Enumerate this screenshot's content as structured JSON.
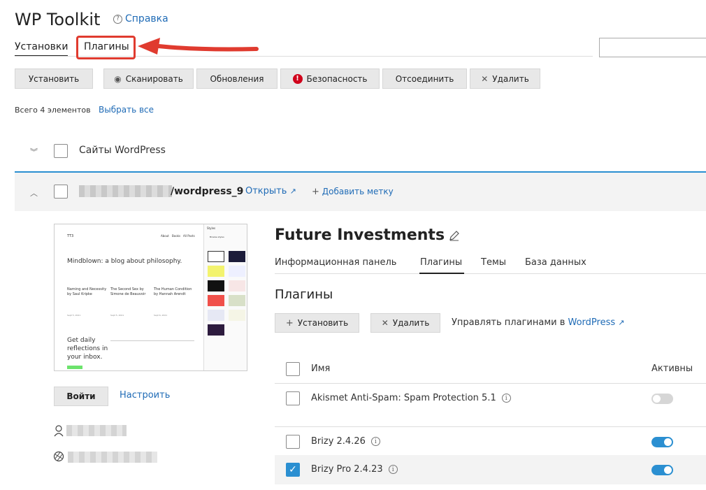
{
  "header": {
    "app_title": "WP Toolkit",
    "help_label": "Справка"
  },
  "main_tabs": [
    {
      "label": "Установки",
      "active": true
    },
    {
      "label": "Плагины",
      "active": false,
      "highlighted": true
    }
  ],
  "annotation": {
    "highlight_color": "#e03b2f"
  },
  "toolbar": {
    "install": "Установить",
    "scan": "Сканировать",
    "updates": "Обновления",
    "security": "Безопасность",
    "detach": "Отсоединить",
    "delete": "Удалить"
  },
  "list": {
    "total_text": "Всего 4 элементов",
    "select_all": "Выбрать все",
    "group_label": "Сайты WordPress"
  },
  "site": {
    "path": "/wordpress_9",
    "open_label": "Открыть",
    "add_tag_label": "Добавить метку",
    "login_label": "Войти",
    "setup_label": "Настроить",
    "title": "Future Investments",
    "preview": {
      "brand": "TT3",
      "nav": [
        "About",
        "Books",
        "All Posts"
      ],
      "headline": "Mindblown: a blog about philosophy.",
      "posts": [
        {
          "title": "Naming and Necessity by Saul Kripke",
          "date": "Sept 5, 2021"
        },
        {
          "title": "The Second Sex by Simone de Beauvoir",
          "date": "Sept 5, 2021"
        },
        {
          "title": "The Human Condition by Hannah Arendt",
          "date": "Sept 6, 2021"
        }
      ],
      "cta": "Get daily reflections in your inbox.",
      "styles_title": "Styles",
      "styles_subtitle": "Browse styles"
    }
  },
  "sub_tabs": [
    {
      "label": "Информационная панель",
      "active": false
    },
    {
      "label": "Плагины",
      "active": true
    },
    {
      "label": "Темы",
      "active": false
    },
    {
      "label": "База данных",
      "active": false
    }
  ],
  "plugins": {
    "heading": "Плагины",
    "install_label": "Установить",
    "delete_label": "Удалить",
    "manage_prefix": "Управлять плагинами в ",
    "manage_link": "WordPress",
    "col_name": "Имя",
    "col_active": "Активны",
    "rows": [
      {
        "name": "Akismet Anti-Spam: Spam Protection 5.1",
        "active": false,
        "checked": false
      },
      {
        "name": "Brizy 2.4.26",
        "active": true,
        "checked": false
      },
      {
        "name": "Brizy Pro 2.4.23",
        "active": true,
        "checked": true
      }
    ]
  },
  "colors": {
    "accent": "#2b8fd1",
    "link": "#1f6bb6",
    "danger": "#d0021b"
  }
}
